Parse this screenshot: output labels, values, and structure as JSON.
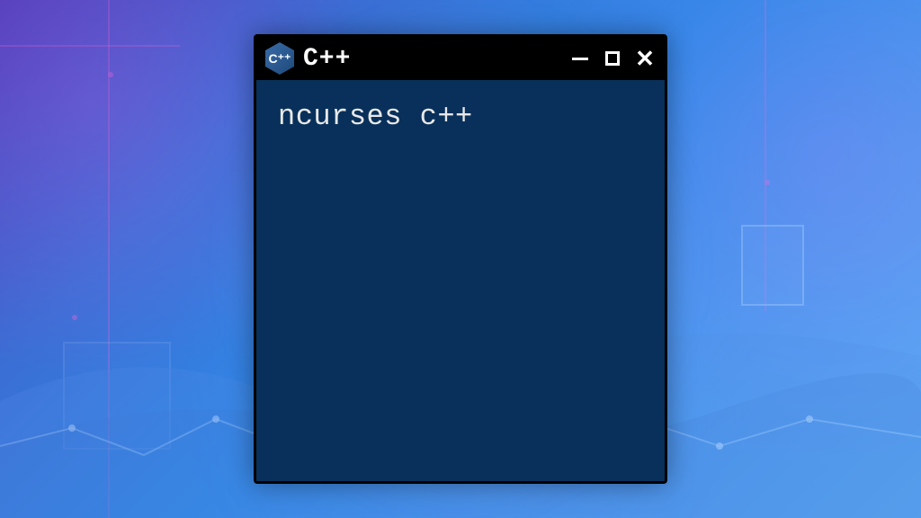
{
  "window": {
    "title": "C++",
    "icon_label": "C++",
    "content_text": "ncurses c++"
  },
  "controls": {
    "minimize": "minimize",
    "maximize": "maximize",
    "close": "close"
  }
}
